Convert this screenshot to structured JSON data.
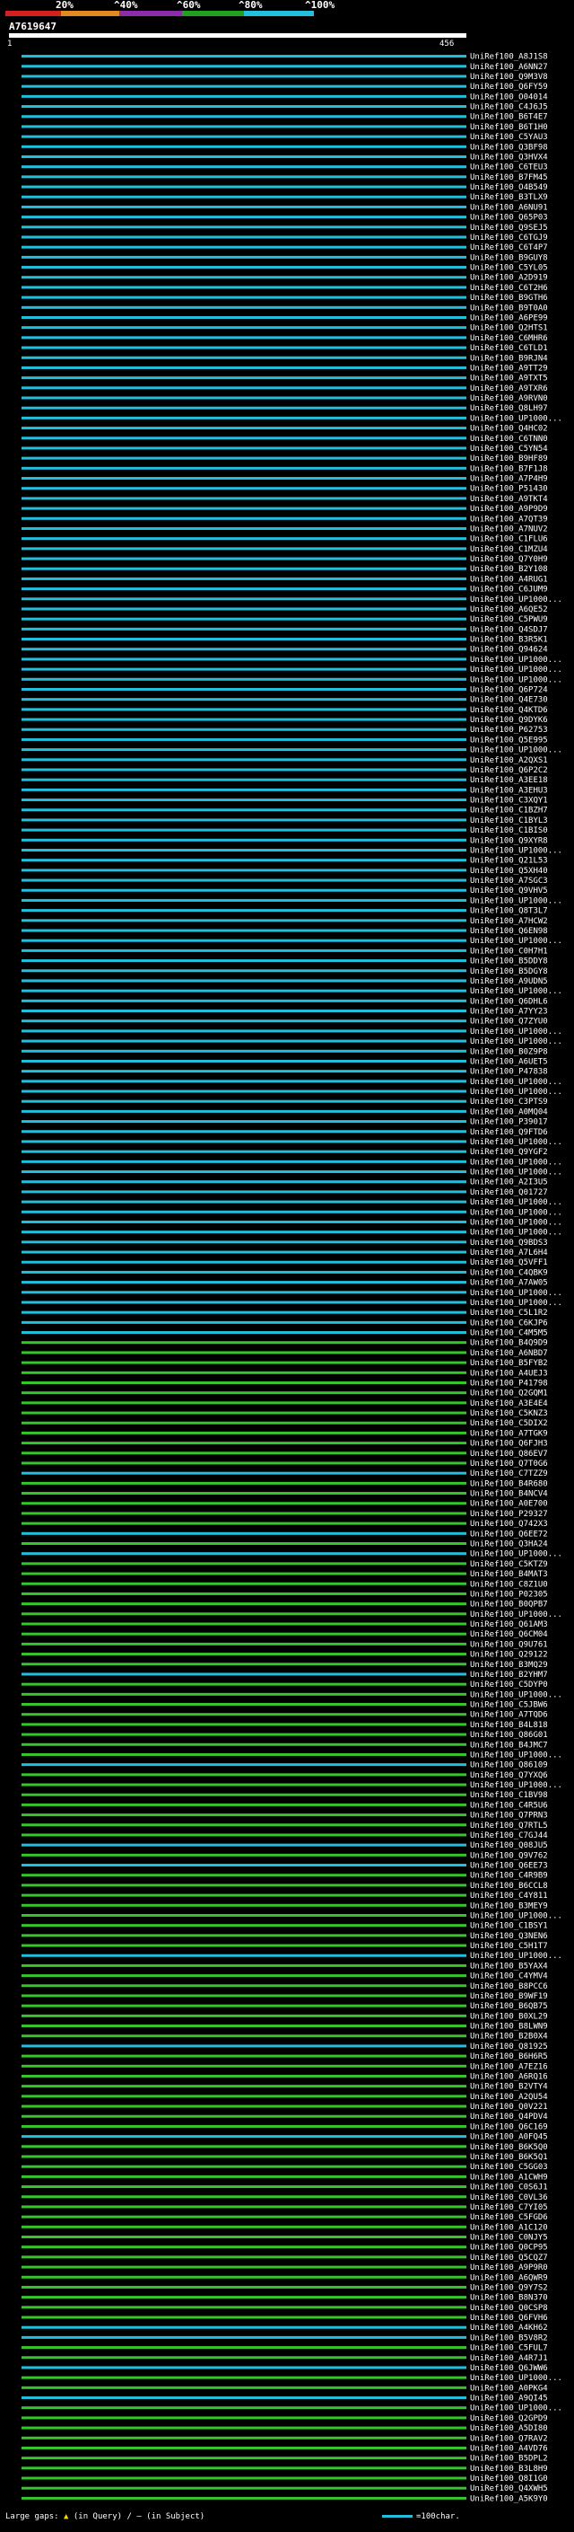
{
  "legend": {
    "labels": [
      "20%",
      "^40%",
      "^60%",
      "^80%",
      "^100%"
    ],
    "colors": [
      "#d32020",
      "#e28a20",
      "#8b2ca8",
      "#1fa01f",
      "#23c0de"
    ]
  },
  "query": {
    "title": "A7619647",
    "start": "1",
    "end": "456"
  },
  "colors": {
    "cyan": "#23c0de",
    "green": "#36c62c",
    "bg": "#000000"
  },
  "rows": [
    {
      "id": "UniRef100_A8J1S8",
      "c": "c"
    },
    {
      "id": "UniRef100_A6NN27",
      "c": "c"
    },
    {
      "id": "UniRef100_Q9M3V8",
      "c": "c"
    },
    {
      "id": "UniRef100_Q6FY59",
      "c": "c"
    },
    {
      "id": "UniRef100_O04014",
      "c": "c"
    },
    {
      "id": "UniRef100_C4J6J5",
      "c": "c"
    },
    {
      "id": "UniRef100_B6T4E7",
      "c": "c"
    },
    {
      "id": "UniRef100_B6T1H0",
      "c": "c"
    },
    {
      "id": "UniRef100_C5YAU3",
      "c": "c"
    },
    {
      "id": "UniRef100_Q3BF98",
      "c": "c"
    },
    {
      "id": "UniRef100_Q3HVX4",
      "c": "c"
    },
    {
      "id": "UniRef100_C6TEU3",
      "c": "c"
    },
    {
      "id": "UniRef100_B7FM45",
      "c": "c"
    },
    {
      "id": "UniRef100_O4B549",
      "c": "c"
    },
    {
      "id": "UniRef100_B3TLX9",
      "c": "c"
    },
    {
      "id": "UniRef100_A6NU91",
      "c": "c"
    },
    {
      "id": "UniRef100_Q65P03",
      "c": "c"
    },
    {
      "id": "UniRef100_Q9SEJ5",
      "c": "c"
    },
    {
      "id": "UniRef100_C6TGJ9",
      "c": "c"
    },
    {
      "id": "UniRef100_C6T4P7",
      "c": "c"
    },
    {
      "id": "UniRef100_B9GUY8",
      "c": "c"
    },
    {
      "id": "UniRef100_C5YL05",
      "c": "c"
    },
    {
      "id": "UniRef100_A2D919",
      "c": "c"
    },
    {
      "id": "UniRef100_C6T2H6",
      "c": "c"
    },
    {
      "id": "UniRef100_B9GTH6",
      "c": "c"
    },
    {
      "id": "UniRef100_B9T0A0",
      "c": "c"
    },
    {
      "id": "UniRef100_A6PE99",
      "c": "c"
    },
    {
      "id": "UniRef100_Q2HTS1",
      "c": "c"
    },
    {
      "id": "UniRef100_C6MHR6",
      "c": "c"
    },
    {
      "id": "UniRef100_C6TLD1",
      "c": "c"
    },
    {
      "id": "UniRef100_B9RJN4",
      "c": "c"
    },
    {
      "id": "UniRef100_A9TT29",
      "c": "c"
    },
    {
      "id": "UniRef100_A9TXT5",
      "c": "c"
    },
    {
      "id": "UniRef100_A9TXR6",
      "c": "c"
    },
    {
      "id": "UniRef100_A9RVN0",
      "c": "c"
    },
    {
      "id": "UniRef100_Q8LH97",
      "c": "c"
    },
    {
      "id": "UniRef100_UP1000...",
      "c": "c"
    },
    {
      "id": "UniRef100_Q4HC02",
      "c": "c"
    },
    {
      "id": "UniRef100_C6TNN0",
      "c": "c"
    },
    {
      "id": "UniRef100_C5YN54",
      "c": "c"
    },
    {
      "id": "UniRef100_B9HF89",
      "c": "c"
    },
    {
      "id": "UniRef100_B7F1J8",
      "c": "c"
    },
    {
      "id": "UniRef100_A7P4H9",
      "c": "c"
    },
    {
      "id": "UniRef100_P51430",
      "c": "c"
    },
    {
      "id": "UniRef100_A9TKT4",
      "c": "c"
    },
    {
      "id": "UniRef100_A9P9D9",
      "c": "c"
    },
    {
      "id": "UniRef100_A7QT39",
      "c": "c"
    },
    {
      "id": "UniRef100_A7NUV2",
      "c": "c"
    },
    {
      "id": "UniRef100_C1FLU6",
      "c": "c"
    },
    {
      "id": "UniRef100_C1MZU4",
      "c": "c"
    },
    {
      "id": "UniRef100_Q7Y0H9",
      "c": "c"
    },
    {
      "id": "UniRef100_B2Y108",
      "c": "c"
    },
    {
      "id": "UniRef100_A4RUG1",
      "c": "c"
    },
    {
      "id": "UniRef100_C6JUM9",
      "c": "c"
    },
    {
      "id": "UniRef100_UP1000...",
      "c": "c"
    },
    {
      "id": "UniRef100_A6QE52",
      "c": "c"
    },
    {
      "id": "UniRef100_C5PWU9",
      "c": "c"
    },
    {
      "id": "UniRef100_Q4SDJ7",
      "c": "c"
    },
    {
      "id": "UniRef100_B3R5K1",
      "c": "c"
    },
    {
      "id": "UniRef100_Q94624",
      "c": "c"
    },
    {
      "id": "UniRef100_UP1000...",
      "c": "c"
    },
    {
      "id": "UniRef100_UP1000...",
      "c": "c"
    },
    {
      "id": "UniRef100_UP1000...",
      "c": "c"
    },
    {
      "id": "UniRef100_Q6P724",
      "c": "c"
    },
    {
      "id": "UniRef100_Q4E730",
      "c": "c"
    },
    {
      "id": "UniRef100_Q4KTD6",
      "c": "c"
    },
    {
      "id": "UniRef100_Q9DYK6",
      "c": "c"
    },
    {
      "id": "UniRef100_P62753",
      "c": "c"
    },
    {
      "id": "UniRef100_Q5E995",
      "c": "c"
    },
    {
      "id": "UniRef100_UP1000...",
      "c": "c"
    },
    {
      "id": "UniRef100_A2QXS1",
      "c": "c"
    },
    {
      "id": "UniRef100_Q6P2C2",
      "c": "c"
    },
    {
      "id": "UniRef100_A3EE18",
      "c": "c"
    },
    {
      "id": "UniRef100_A3EHU3",
      "c": "c"
    },
    {
      "id": "UniRef100_C3XQY1",
      "c": "c"
    },
    {
      "id": "UniRef100_C1BZH7",
      "c": "c"
    },
    {
      "id": "UniRef100_C1BYL3",
      "c": "c"
    },
    {
      "id": "UniRef100_C1BIS0",
      "c": "c"
    },
    {
      "id": "UniRef100_Q9XYR8",
      "c": "c"
    },
    {
      "id": "UniRef100_UP1000...",
      "c": "c"
    },
    {
      "id": "UniRef100_Q21L53",
      "c": "c"
    },
    {
      "id": "UniRef100_Q5XH40",
      "c": "c"
    },
    {
      "id": "UniRef100_A7SGC3",
      "c": "c"
    },
    {
      "id": "UniRef100_Q9VHV5",
      "c": "c"
    },
    {
      "id": "UniRef100_UP1000...",
      "c": "c"
    },
    {
      "id": "UniRef100_Q8T3L7",
      "c": "c"
    },
    {
      "id": "UniRef100_A7HCW2",
      "c": "c"
    },
    {
      "id": "UniRef100_Q6EN98",
      "c": "c"
    },
    {
      "id": "UniRef100_UP1000...",
      "c": "c"
    },
    {
      "id": "UniRef100_C0H7H1",
      "c": "c"
    },
    {
      "id": "UniRef100_B5DDY8",
      "c": "c"
    },
    {
      "id": "UniRef100_B5DGY8",
      "c": "c"
    },
    {
      "id": "UniRef100_A9UDN5",
      "c": "c"
    },
    {
      "id": "UniRef100_UP1000...",
      "c": "c"
    },
    {
      "id": "UniRef100_Q6DHL6",
      "c": "c"
    },
    {
      "id": "UniRef100_A7YY23",
      "c": "c"
    },
    {
      "id": "UniRef100_Q7ZYU0",
      "c": "c"
    },
    {
      "id": "UniRef100_UP1000...",
      "c": "c"
    },
    {
      "id": "UniRef100_UP1000...",
      "c": "c"
    },
    {
      "id": "UniRef100_B0Z9P8",
      "c": "c"
    },
    {
      "id": "UniRef100_A6UET5",
      "c": "c"
    },
    {
      "id": "UniRef100_P47838",
      "c": "c"
    },
    {
      "id": "UniRef100_UP1000...",
      "c": "c"
    },
    {
      "id": "UniRef100_UP1000...",
      "c": "c"
    },
    {
      "id": "UniRef100_C3PTS9",
      "c": "c"
    },
    {
      "id": "UniRef100_A0MQ04",
      "c": "c"
    },
    {
      "id": "UniRef100_P39017",
      "c": "c"
    },
    {
      "id": "UniRef100_Q9FTD6",
      "c": "c"
    },
    {
      "id": "UniRef100_UP1000...",
      "c": "c"
    },
    {
      "id": "UniRef100_Q9YGF2",
      "c": "c"
    },
    {
      "id": "UniRef100_UP1000...",
      "c": "c"
    },
    {
      "id": "UniRef100_UP1000...",
      "c": "c"
    },
    {
      "id": "UniRef100_A2I3U5",
      "c": "c"
    },
    {
      "id": "UniRef100_Q01727",
      "c": "c"
    },
    {
      "id": "UniRef100_UP1000...",
      "c": "c"
    },
    {
      "id": "UniRef100_UP1000...",
      "c": "c"
    },
    {
      "id": "UniRef100_UP1000...",
      "c": "c"
    },
    {
      "id": "UniRef100_UP1000...",
      "c": "c"
    },
    {
      "id": "UniRef100_Q9BDS3",
      "c": "c"
    },
    {
      "id": "UniRef100_A7L6H4",
      "c": "c"
    },
    {
      "id": "UniRef100_Q5VFF1",
      "c": "c"
    },
    {
      "id": "UniRef100_C4QBK9",
      "c": "c"
    },
    {
      "id": "UniRef100_A7AW05",
      "c": "c"
    },
    {
      "id": "UniRef100_UP1000...",
      "c": "c"
    },
    {
      "id": "UniRef100_UP1000...",
      "c": "c"
    },
    {
      "id": "UniRef100_C5L1R2",
      "c": "c"
    },
    {
      "id": "UniRef100_C6KJP6",
      "c": "c"
    },
    {
      "id": "UniRef100_C4M5M5",
      "c": "c"
    },
    {
      "id": "UniRef100_B4Q9D9",
      "c": "g"
    },
    {
      "id": "UniRef100_A6NBD7",
      "c": "g"
    },
    {
      "id": "UniRef100_B5FYB2",
      "c": "g"
    },
    {
      "id": "UniRef100_A4UEJ3",
      "c": "g"
    },
    {
      "id": "UniRef100_P41798",
      "c": "g"
    },
    {
      "id": "UniRef100_Q2GQM1",
      "c": "g"
    },
    {
      "id": "UniRef100_A3E4E4",
      "c": "g"
    },
    {
      "id": "UniRef100_C5KNZ3",
      "c": "g"
    },
    {
      "id": "UniRef100_C5DIX2",
      "c": "g"
    },
    {
      "id": "UniRef100_A7TGK9",
      "c": "g"
    },
    {
      "id": "UniRef100_Q6FJH3",
      "c": "g"
    },
    {
      "id": "UniRef100_Q86EV7",
      "c": "g"
    },
    {
      "id": "UniRef100_Q7T0G6",
      "c": "g"
    },
    {
      "id": "UniRef100_C7TZZ9",
      "c": "c"
    },
    {
      "id": "UniRef100_B4R680",
      "c": "g"
    },
    {
      "id": "UniRef100_B4NCV4",
      "c": "g"
    },
    {
      "id": "UniRef100_A0E700",
      "c": "g"
    },
    {
      "id": "UniRef100_P29327",
      "c": "g"
    },
    {
      "id": "UniRef100_Q742X3",
      "c": "g"
    },
    {
      "id": "UniRef100_Q6EE72",
      "c": "c"
    },
    {
      "id": "UniRef100_Q3HA24",
      "c": "g"
    },
    {
      "id": "UniRef100_UP1000...",
      "c": "c"
    },
    {
      "id": "UniRef100_C5KTZ9",
      "c": "g"
    },
    {
      "id": "UniRef100_B4MAT3",
      "c": "g"
    },
    {
      "id": "UniRef100_C8Z1U0",
      "c": "g"
    },
    {
      "id": "UniRef100_P02305",
      "c": "g"
    },
    {
      "id": "UniRef100_B0QPB7",
      "c": "g"
    },
    {
      "id": "UniRef100_UP1000...",
      "c": "g"
    },
    {
      "id": "UniRef100_Q61AM3",
      "c": "g"
    },
    {
      "id": "UniRef100_Q6CM04",
      "c": "g"
    },
    {
      "id": "UniRef100_Q9U761",
      "c": "g"
    },
    {
      "id": "UniRef100_Q29122",
      "c": "g"
    },
    {
      "id": "UniRef100_B3MQ29",
      "c": "g"
    },
    {
      "id": "UniRef100_B2YHM7",
      "c": "c"
    },
    {
      "id": "UniRef100_C5DYP0",
      "c": "g"
    },
    {
      "id": "UniRef100_UP1000...",
      "c": "g"
    },
    {
      "id": "UniRef100_C5JBW6",
      "c": "g"
    },
    {
      "id": "UniRef100_A7TQD6",
      "c": "g"
    },
    {
      "id": "UniRef100_B4L818",
      "c": "g"
    },
    {
      "id": "UniRef100_Q86G01",
      "c": "g"
    },
    {
      "id": "UniRef100_B4JMC7",
      "c": "g"
    },
    {
      "id": "UniRef100_UP1000...",
      "c": "g"
    },
    {
      "id": "UniRef100_Q86109",
      "c": "c"
    },
    {
      "id": "UniRef100_Q7YXQ6",
      "c": "g"
    },
    {
      "id": "UniRef100_UP1000...",
      "c": "g"
    },
    {
      "id": "UniRef100_C1BV98",
      "c": "g"
    },
    {
      "id": "UniRef100_C4R5U6",
      "c": "g"
    },
    {
      "id": "UniRef100_Q7PRN3",
      "c": "g"
    },
    {
      "id": "UniRef100_Q7RTL5",
      "c": "g"
    },
    {
      "id": "UniRef100_C7GJ44",
      "c": "g"
    },
    {
      "id": "UniRef100_Q08JU5",
      "c": "c"
    },
    {
      "id": "UniRef100_Q9V762",
      "c": "g"
    },
    {
      "id": "UniRef100_Q6EE73",
      "c": "c"
    },
    {
      "id": "UniRef100_C4R9B9",
      "c": "g"
    },
    {
      "id": "UniRef100_B6CCL8",
      "c": "g"
    },
    {
      "id": "UniRef100_C4Y811",
      "c": "g"
    },
    {
      "id": "UniRef100_B3MEY9",
      "c": "g"
    },
    {
      "id": "UniRef100_UP1000...",
      "c": "g"
    },
    {
      "id": "UniRef100_C1BSY1",
      "c": "g"
    },
    {
      "id": "UniRef100_Q3NEN6",
      "c": "g"
    },
    {
      "id": "UniRef100_C5H1T7",
      "c": "g"
    },
    {
      "id": "UniRef100_UP1000...",
      "c": "c"
    },
    {
      "id": "UniRef100_B5YAX4",
      "c": "g"
    },
    {
      "id": "UniRef100_C4YMV4",
      "c": "g"
    },
    {
      "id": "UniRef100_B8PCC6",
      "c": "g"
    },
    {
      "id": "UniRef100_B9WF19",
      "c": "g"
    },
    {
      "id": "UniRef100_B6QB75",
      "c": "g"
    },
    {
      "id": "UniRef100_B0XL29",
      "c": "g"
    },
    {
      "id": "UniRef100_B8LWN9",
      "c": "g"
    },
    {
      "id": "UniRef100_B2B0X4",
      "c": "g"
    },
    {
      "id": "UniRef100_Q81925",
      "c": "c"
    },
    {
      "id": "UniRef100_B6H6R5",
      "c": "g"
    },
    {
      "id": "UniRef100_A7EZ16",
      "c": "g"
    },
    {
      "id": "UniRef100_A6RQ16",
      "c": "g"
    },
    {
      "id": "UniRef100_B2VTY4",
      "c": "g"
    },
    {
      "id": "UniRef100_A2QU54",
      "c": "g"
    },
    {
      "id": "UniRef100_Q0V221",
      "c": "g"
    },
    {
      "id": "UniRef100_Q4PDV4",
      "c": "g"
    },
    {
      "id": "UniRef100_Q6C169",
      "c": "g"
    },
    {
      "id": "UniRef100_A0FQ45",
      "c": "c"
    },
    {
      "id": "UniRef100_B6K5Q0",
      "c": "g"
    },
    {
      "id": "UniRef100_B6K5Q1",
      "c": "g"
    },
    {
      "id": "UniRef100_C5GG03",
      "c": "g"
    },
    {
      "id": "UniRef100_A1CWH9",
      "c": "g"
    },
    {
      "id": "UniRef100_C0S6J1",
      "c": "g"
    },
    {
      "id": "UniRef100_C0VL36",
      "c": "g"
    },
    {
      "id": "UniRef100_C7YI05",
      "c": "g"
    },
    {
      "id": "UniRef100_C5FGD6",
      "c": "g"
    },
    {
      "id": "UniRef100_A1C120",
      "c": "g"
    },
    {
      "id": "UniRef100_C0NJY5",
      "c": "g"
    },
    {
      "id": "UniRef100_Q0CP95",
      "c": "g"
    },
    {
      "id": "UniRef100_Q5CQZ7",
      "c": "g"
    },
    {
      "id": "UniRef100_A9P9R0",
      "c": "g"
    },
    {
      "id": "UniRef100_A6QWR9",
      "c": "g"
    },
    {
      "id": "UniRef100_Q9Y7S2",
      "c": "g"
    },
    {
      "id": "UniRef100_B8N370",
      "c": "g"
    },
    {
      "id": "UniRef100_Q0CSP8",
      "c": "g"
    },
    {
      "id": "UniRef100_Q6FVH6",
      "c": "g"
    },
    {
      "id": "UniRef100_A4KH62",
      "c": "c"
    },
    {
      "id": "UniRef100_B5V8R2",
      "c": "c"
    },
    {
      "id": "UniRef100_C5FUL7",
      "c": "g"
    },
    {
      "id": "UniRef100_A4R7J1",
      "c": "g"
    },
    {
      "id": "UniRef100_Q6JWW6",
      "c": "c"
    },
    {
      "id": "UniRef100_UP1000...",
      "c": "g"
    },
    {
      "id": "UniRef100_A0PKG4",
      "c": "g"
    },
    {
      "id": "UniRef100_A9QI45",
      "c": "c"
    },
    {
      "id": "UniRef100_UP1000...",
      "c": "g"
    },
    {
      "id": "UniRef100_Q2GPD9",
      "c": "g"
    },
    {
      "id": "UniRef100_A5DI80",
      "c": "g"
    },
    {
      "id": "UniRef100_Q7RAV2",
      "c": "g"
    },
    {
      "id": "UniRef100_A4VD76",
      "c": "g"
    },
    {
      "id": "UniRef100_B5DPL2",
      "c": "g"
    },
    {
      "id": "UniRef100_B3L8H9",
      "c": "g"
    },
    {
      "id": "UniRef100_Q8I1G0",
      "c": "g"
    },
    {
      "id": "UniRef100_Q4XWH5",
      "c": "g"
    },
    {
      "id": "UniRef100_A5K9Y0",
      "c": "g"
    }
  ],
  "footer": {
    "gap_label": "Large gaps:",
    "gap_query": "(in Query)",
    "gap_sep": "/",
    "gap_subject": "(in Subject)",
    "gap_query_mark": "▲",
    "gap_subject_mark": "–",
    "scale_label": "=100char."
  }
}
